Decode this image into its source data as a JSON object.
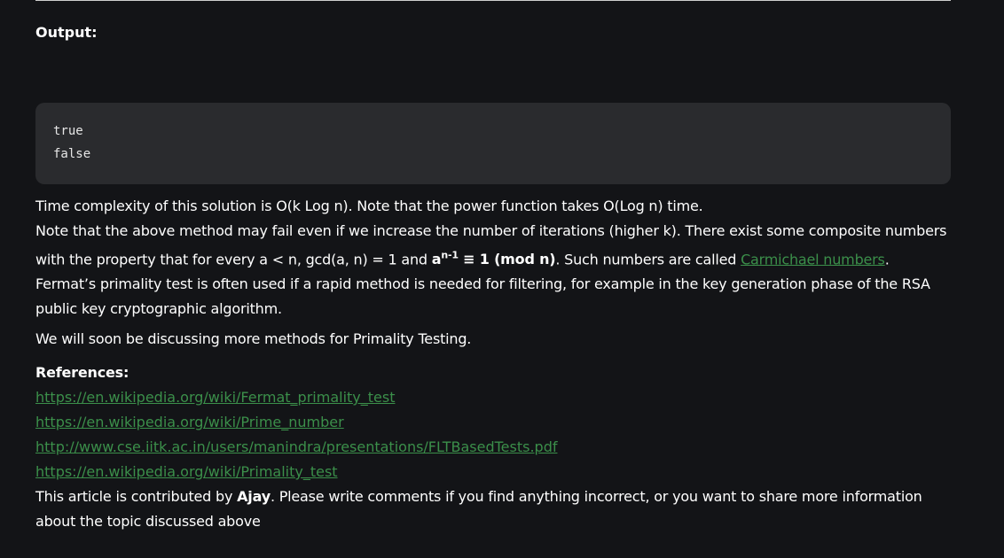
{
  "output_label": "Output:",
  "code": {
    "lines": [
      "true",
      "false"
    ]
  },
  "article": {
    "complexity": "Time complexity of this solution is O(k Log n). Note that the power function takes O(Log n) time.",
    "note_part1": "Note that the above method may fail even if we increase the number of iterations (higher k). There exist some composite numbers with the property that for every a < n, gcd(a, n) = 1 and ",
    "note_formula_base": "a",
    "note_formula_exp": "n-1",
    "note_formula_rest": " ≡ 1 (mod n)",
    "note_part2": ". Such numbers are called ",
    "carmichael_link": "Carmichael numbers",
    "note_part3": ". Fermat’s primality test is often used if a rapid method is needed for filtering, for example in the key generation phase of the RSA public key cryptographic algorithm.",
    "soon": "We will soon be discussing more methods for Primality Testing.",
    "references_label": "References:",
    "references": [
      "https://en.wikipedia.org/wiki/Fermat_primality_test",
      "https://en.wikipedia.org/wiki/Prime_number",
      "http://www.cse.iitk.ac.in/users/manindra/presentations/FLTBasedTests.pdf",
      "https://en.wikipedia.org/wiki/Primality_test"
    ],
    "contrib_part1": "This article is contributed by ",
    "contrib_author": "Ajay",
    "contrib_part2": ". Please write comments if you find anything incorrect, or you want to share more information about the topic discussed above"
  },
  "colors": {
    "background": "#131417",
    "code_background": "#2a2b2e",
    "link": "#3b8f4a",
    "text": "#ffffff"
  }
}
